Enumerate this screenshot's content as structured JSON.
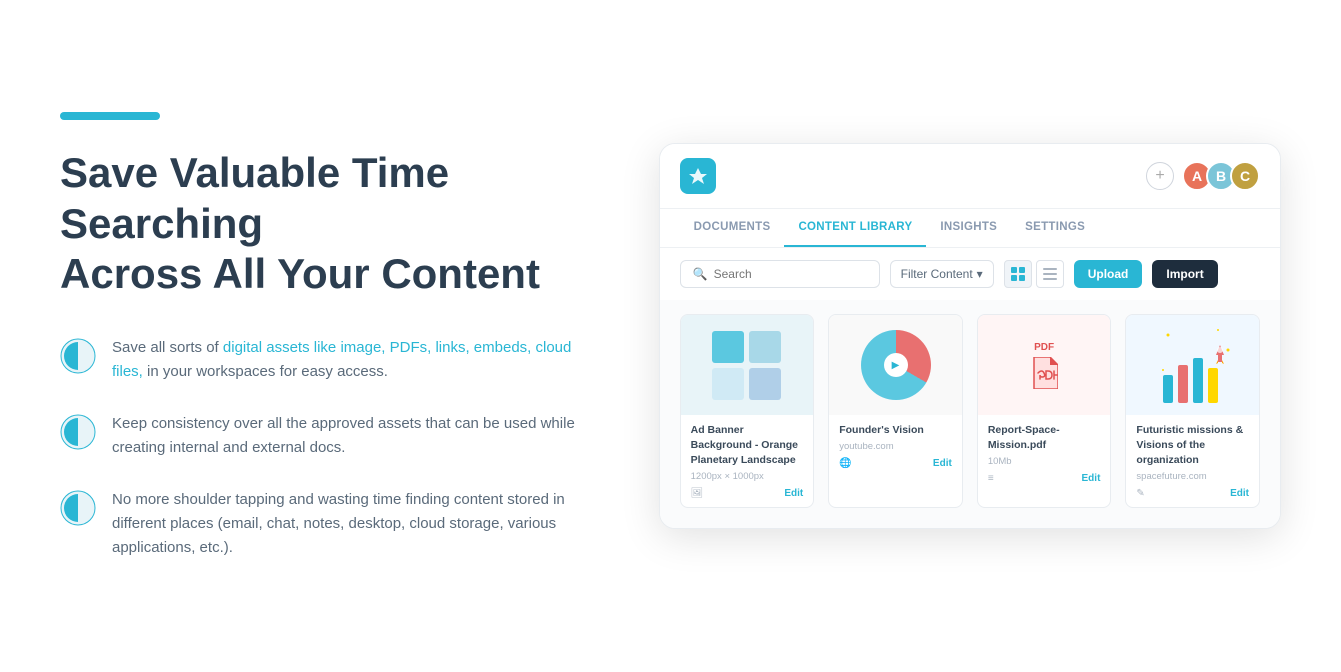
{
  "accent_bar": {},
  "heading": {
    "line1": "Save Valuable Time Searching",
    "line2": "Across All Your Content"
  },
  "features": [
    {
      "text_parts": [
        {
          "text": "Save all sorts of ",
          "type": "normal"
        },
        {
          "text": "digital assets like image, PDFs, links,",
          "type": "highlight"
        },
        {
          "text": " embeds, cloud files, in your workspaces for easy access.",
          "type": "normal"
        }
      ],
      "combined": "Save all sorts of digital assets like image, PDFs, links, embeds, cloud files, in your workspaces for easy access."
    },
    {
      "combined": "Keep consistency over all the approved assets that can be used while creating internal and external docs."
    },
    {
      "combined": "No more shoulder tapping and wasting time finding content stored in different places (email, chat, notes, desktop, cloud storage, various applications, etc.)."
    }
  ],
  "app": {
    "logo_icon": "✦",
    "add_btn_label": "+",
    "nav_tabs": [
      {
        "label": "DOCUMENTS",
        "active": false
      },
      {
        "label": "CONTENT LiBrARY",
        "active": true
      },
      {
        "label": "INSIGHTS",
        "active": false
      },
      {
        "label": "SETTINGS",
        "active": false
      }
    ],
    "toolbar": {
      "search_placeholder": "Search",
      "filter_label": "Filter Content",
      "upload_label": "Upload",
      "import_label": "Import"
    },
    "cards": [
      {
        "title": "Ad Banner Background - Orange Planetary Landscape",
        "subtitle": "1200px × 1000px",
        "source": "",
        "type": "image"
      },
      {
        "title": "Founder's Vision",
        "subtitle": "youtube.com",
        "source": "youtube.com",
        "type": "video"
      },
      {
        "title": "Report-Space-Mission.pdf",
        "subtitle": "10Mb",
        "source": "",
        "type": "pdf"
      },
      {
        "title": "Futuristic missions & Visions of the organization",
        "subtitle": "spacefuture.com",
        "source": "spacefuture.com",
        "type": "futuristic"
      }
    ],
    "edit_label": "Edit"
  },
  "colors": {
    "accent": "#29b6d4",
    "dark": "#1e2d3d",
    "text_primary": "#2c3e50",
    "text_secondary": "#5a6a7a"
  }
}
